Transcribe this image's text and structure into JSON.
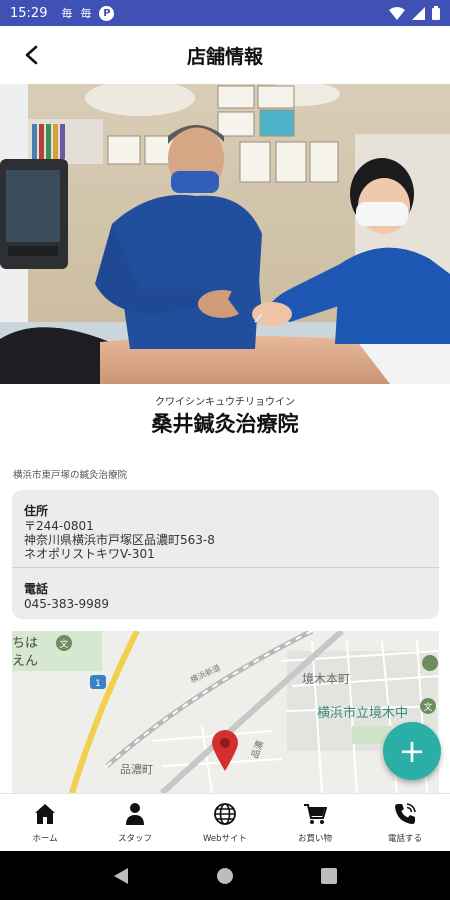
{
  "status_bar": {
    "time": "15:29",
    "left_icons": [
      "毎",
      "毎",
      "P"
    ]
  },
  "app_bar": {
    "title": "店舗情報"
  },
  "clinic": {
    "kana": "クワイシンキュウチリョウイン",
    "name": "桑井鍼灸治療院",
    "catchphrase": "横浜市東戸塚の鍼灸治療院"
  },
  "info": {
    "address_label": "住所",
    "postal": "〒244-0801",
    "address_line1": "神奈川県横浜市戸塚区品濃町563-8",
    "address_line2": "ネオポリストキワV-301",
    "phone_label": "電話",
    "phone": "045-383-9989"
  },
  "map": {
    "labels": [
      "ちは",
      "えん",
      "境木本町",
      "横浜市立境木中",
      "品濃町",
      "品濃",
      "横浜新道",
      "1"
    ],
    "accent_color": "#d32f2f"
  },
  "fab": {
    "symbol": "+",
    "color": "#2aaea6"
  },
  "bottom_nav": {
    "items": [
      {
        "label": "ホーム",
        "icon": "home-icon"
      },
      {
        "label": "スタッフ",
        "icon": "person-icon"
      },
      {
        "label": "Webサイト",
        "icon": "globe-icon"
      },
      {
        "label": "お買い物",
        "icon": "cart-icon"
      },
      {
        "label": "電話する",
        "icon": "phone-icon"
      }
    ]
  },
  "colors": {
    "status_bar": "#3f51b5",
    "accent": "#2aaea6"
  }
}
